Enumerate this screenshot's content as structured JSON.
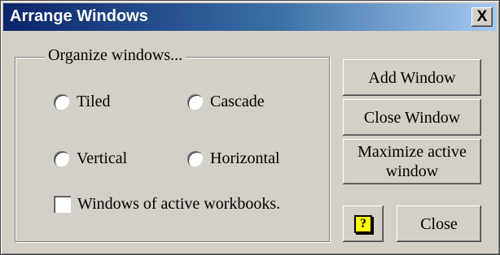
{
  "window": {
    "title": "Arrange Windows",
    "close_glyph": "X"
  },
  "organize": {
    "legend": "Organize  windows...",
    "options": [
      {
        "label": "Tiled",
        "selected": false
      },
      {
        "label": "Cascade",
        "selected": false
      },
      {
        "label": "Vertical",
        "selected": false
      },
      {
        "label": "Horizontal",
        "selected": false
      }
    ],
    "checkbox_label": "Windows of active workbooks.",
    "checkbox_checked": false
  },
  "buttons": {
    "add_window": "Add Window",
    "close_window": "Close Window",
    "maximize_active_window": "Maximize active window",
    "help_icon": "help-icon",
    "help_glyph": "?",
    "close": "Close"
  }
}
